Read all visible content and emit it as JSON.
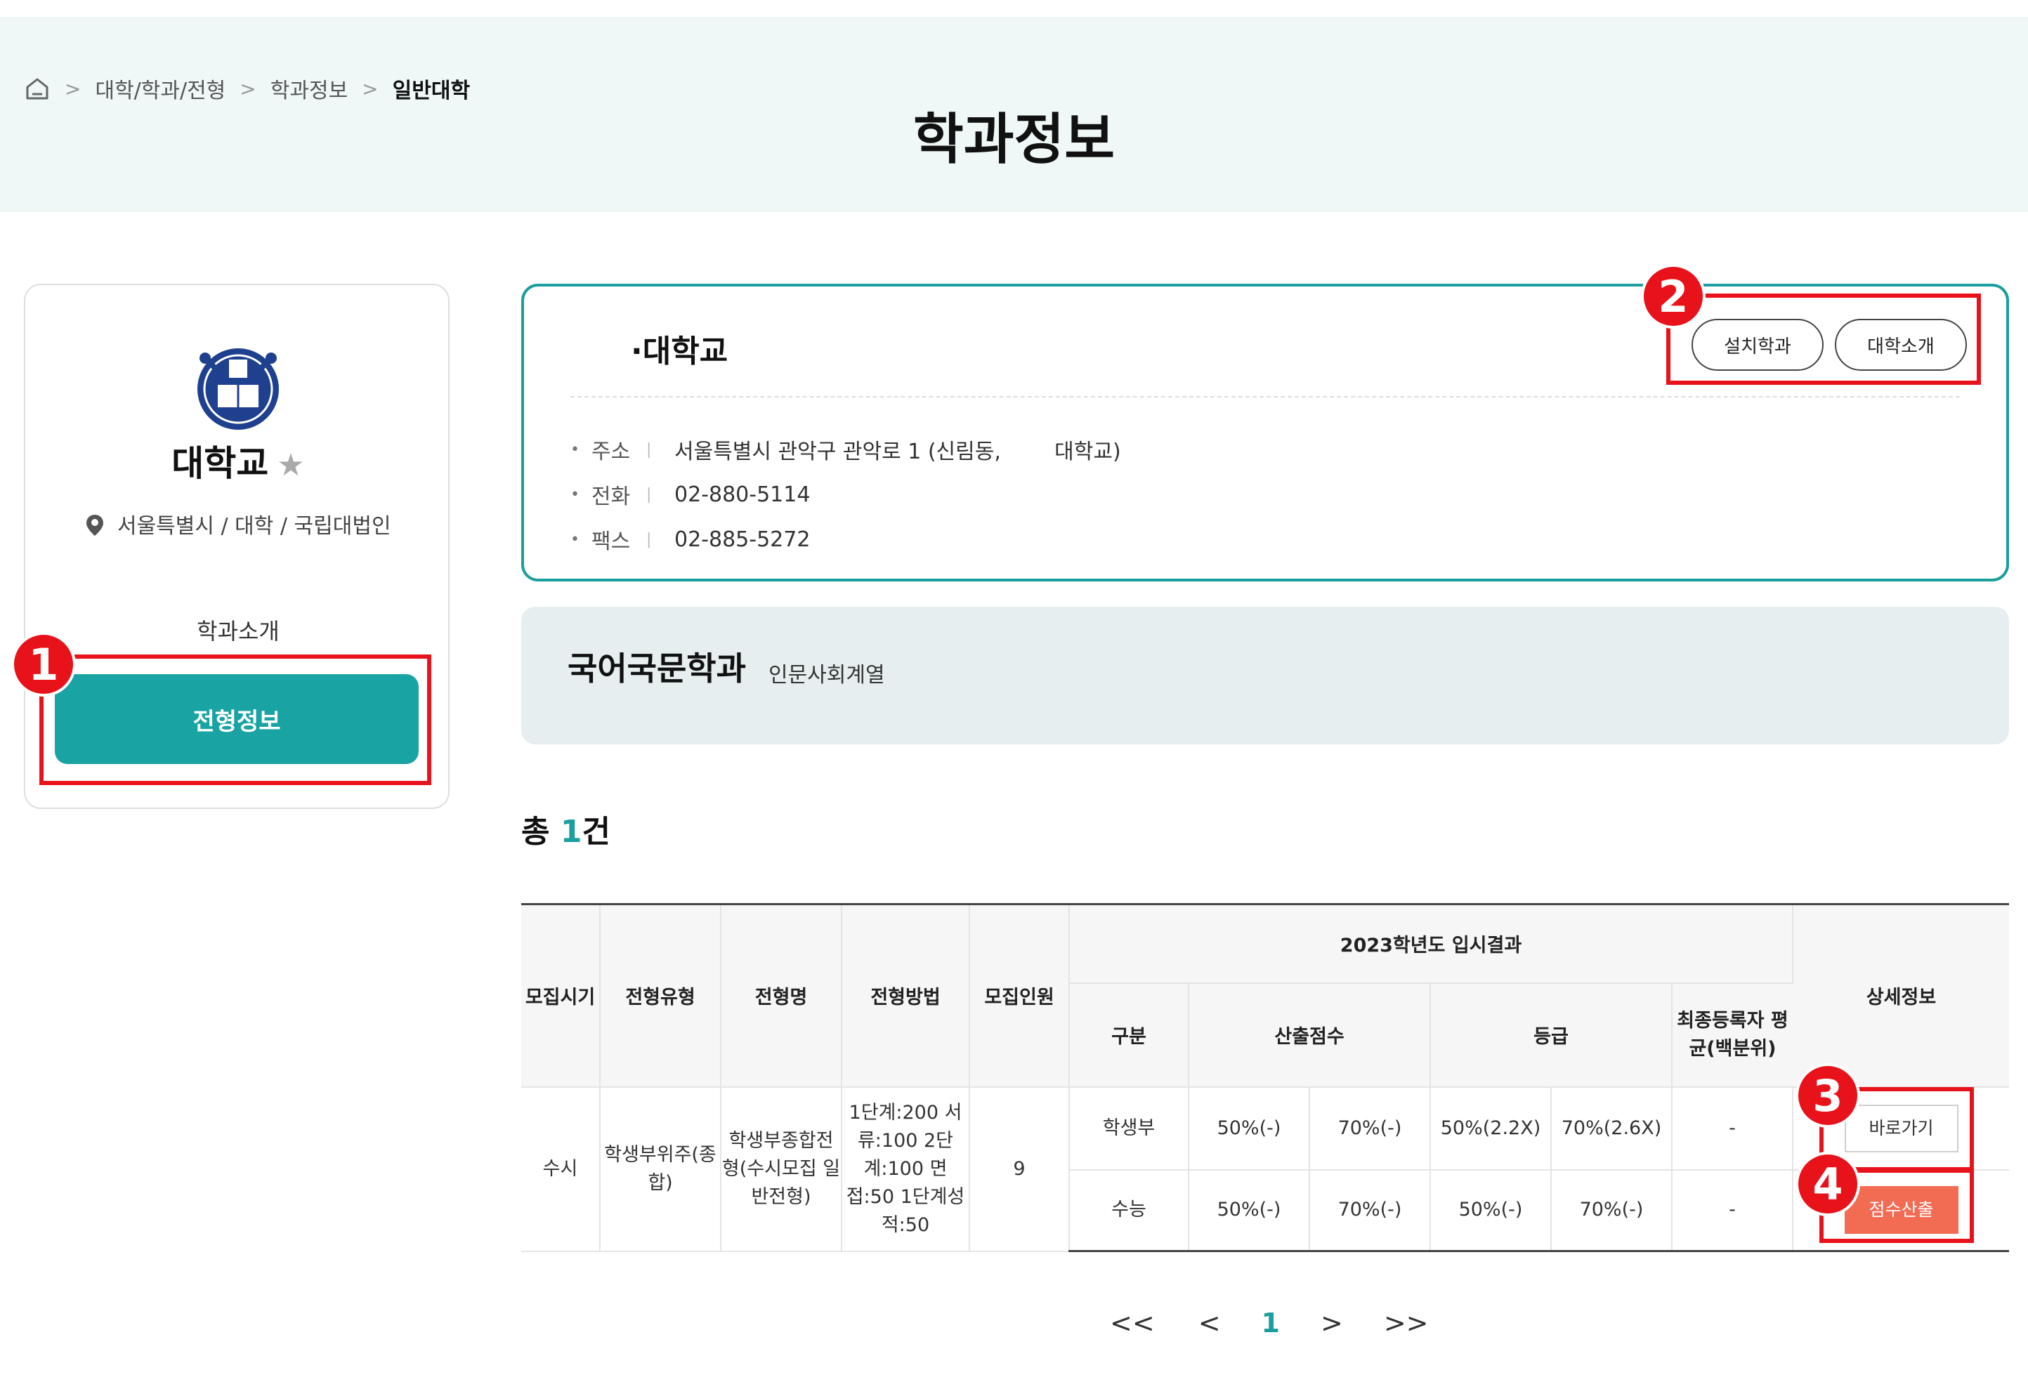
{
  "breadcrumb": {
    "items": [
      "대학/학과/전형",
      "학과정보"
    ],
    "current": "일반대학"
  },
  "page_title": "학과정보",
  "sidebar": {
    "university_name": "대학교",
    "location": "서울특별시 / 대학 / 국립대법인",
    "dept_intro": "학과소개",
    "admission_info_button": "전형정보"
  },
  "info_box": {
    "title": "·대학교",
    "buttons": {
      "departments": "설치학과",
      "introduction": "대학소개"
    },
    "fields": [
      {
        "label": "주소",
        "value": "서울특별시 관악구 관악로 1 (신림동,        대학교)"
      },
      {
        "label": "전화",
        "value": "02-880-5114"
      },
      {
        "label": "팩스",
        "value": "02-885-5272"
      }
    ]
  },
  "department": {
    "name": "국어국문학과",
    "category": "인문사회계열"
  },
  "total": {
    "prefix": "총 ",
    "count": "1",
    "suffix": "건"
  },
  "table": {
    "headers": {
      "period": "모집시기",
      "type": "전형유형",
      "name": "전형명",
      "method": "전형방법",
      "quota": "모집인원",
      "result_group": "2023학년도 입시결과",
      "division": "구분",
      "calc_score": "산출점수",
      "grade": "등급",
      "final_avg": "최종등록자 평균(백분위)",
      "detail": "상세정보"
    },
    "row": {
      "period": "수시",
      "type": "학생부위주(종합)",
      "name": "학생부종합전형(수시모집 일반전형)",
      "method": "1단계:200 서류:100 2단계:100 면접:50 1단계성적:50",
      "quota": "9",
      "sub_rows": [
        {
          "division": "학생부",
          "score1": "50%(-)",
          "score2": "70%(-)",
          "grade1": "50%(2.2X)",
          "grade2": "70%(2.6X)",
          "final": "-"
        },
        {
          "division": "수능",
          "score1": "50%(-)",
          "score2": "70%(-)",
          "grade1": "50%(-)",
          "grade2": "70%(-)",
          "final": "-"
        }
      ],
      "go_button": "바로가기",
      "score_button": "점수산출"
    }
  },
  "pagination": {
    "first": "<<",
    "prev": "<",
    "current": "1",
    "next": ">",
    "last": ">>"
  },
  "annotations": [
    "1",
    "2",
    "3",
    "4"
  ],
  "colors": {
    "accent": "#1aa3a3",
    "annotation": "#e8121b",
    "score_button": "#f26b53",
    "header_bg": "#eff7f7"
  }
}
